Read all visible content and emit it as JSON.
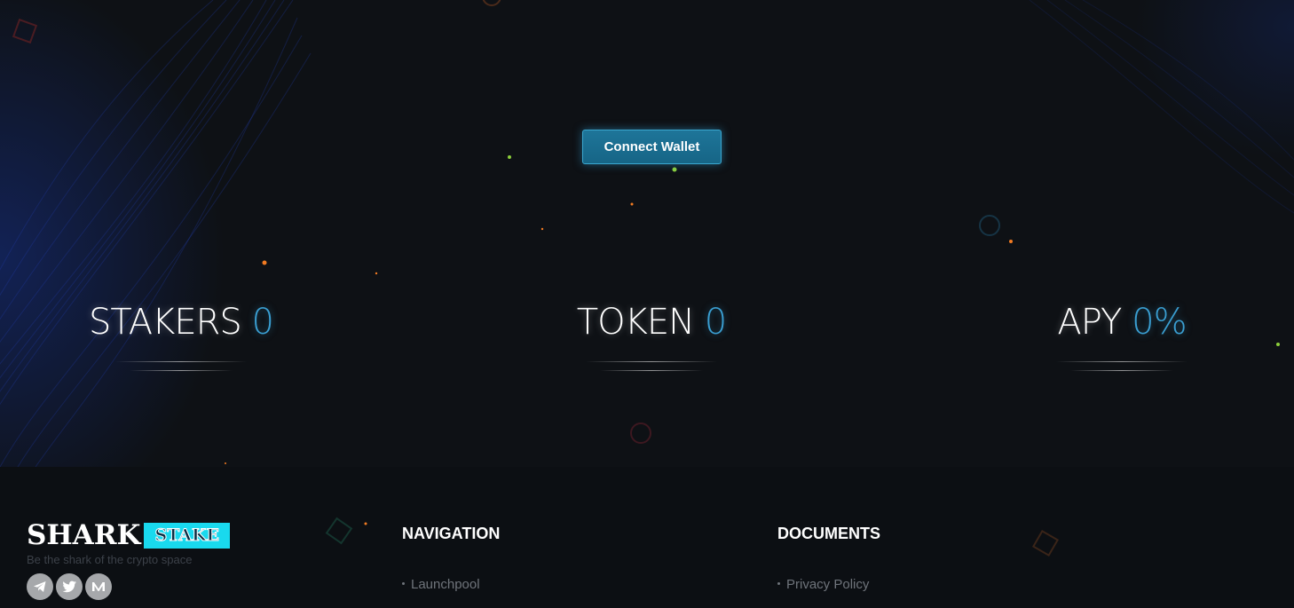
{
  "hero": {
    "connect_wallet_label": "Connect Wallet"
  },
  "stats": [
    {
      "label": "STAKERS",
      "value": "0"
    },
    {
      "label": "TOKEN",
      "value": "0"
    },
    {
      "label": "APY",
      "value": "0%"
    }
  ],
  "footer": {
    "logo": {
      "primary": "SHARK",
      "secondary": "STAKE"
    },
    "tagline": "Be the shark of the crypto space",
    "social": [
      {
        "name": "telegram-icon"
      },
      {
        "name": "twitter-icon"
      },
      {
        "name": "medium-icon"
      }
    ],
    "navigation": {
      "title": "NAVIGATION",
      "links": [
        "Launchpool"
      ]
    },
    "documents": {
      "title": "DOCUMENTS",
      "links": [
        "Privacy Policy"
      ]
    }
  },
  "colors": {
    "accent": "#3a9ed1",
    "button": "#1b6f92",
    "logo_accent": "#19d9ee",
    "background": "#0e1115"
  }
}
